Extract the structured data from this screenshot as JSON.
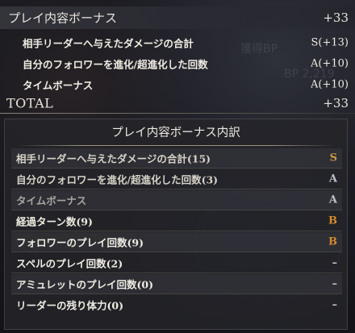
{
  "summary": {
    "header": {
      "label": "プレイ内容ボーナス",
      "value": "+33"
    },
    "items": [
      {
        "label": "相手リーダーへ与えたダメージの合計",
        "value": "S(+13)"
      },
      {
        "label": "自分のフォロワーを進化/超進化した回数",
        "value": "A(+10)"
      },
      {
        "label": "タイムボーナス",
        "value": "A(+10)"
      }
    ],
    "total": {
      "label": "TOTAL",
      "value": "+33"
    }
  },
  "breakdown": {
    "title": "プレイ内容ボーナス内訳",
    "rows": [
      {
        "label": "相手リーダーへ与えたダメージの合計(15)",
        "grade": "S"
      },
      {
        "label": "自分のフォロワーを進化/超進化した回数(3)",
        "grade": "A"
      },
      {
        "label": "タイムボーナス",
        "grade": "A"
      },
      {
        "label": "経過ターン数(9)",
        "grade": "B"
      },
      {
        "label": "フォロワーのプレイ回数(9)",
        "grade": "B"
      },
      {
        "label": "スペルのプレイ回数(2)",
        "grade": "–"
      },
      {
        "label": "アミュレットのプレイ回数(0)",
        "grade": "–"
      },
      {
        "label": "リーダーの残り体力(0)",
        "grade": "–"
      }
    ]
  },
  "background": {
    "ghost_texts": [
      "獲得BP",
      "BP 2,219"
    ]
  },
  "colors": {
    "grade_S": "#c99a45",
    "grade_A": "#bcc3cc",
    "grade_B": "#d48a2c"
  }
}
